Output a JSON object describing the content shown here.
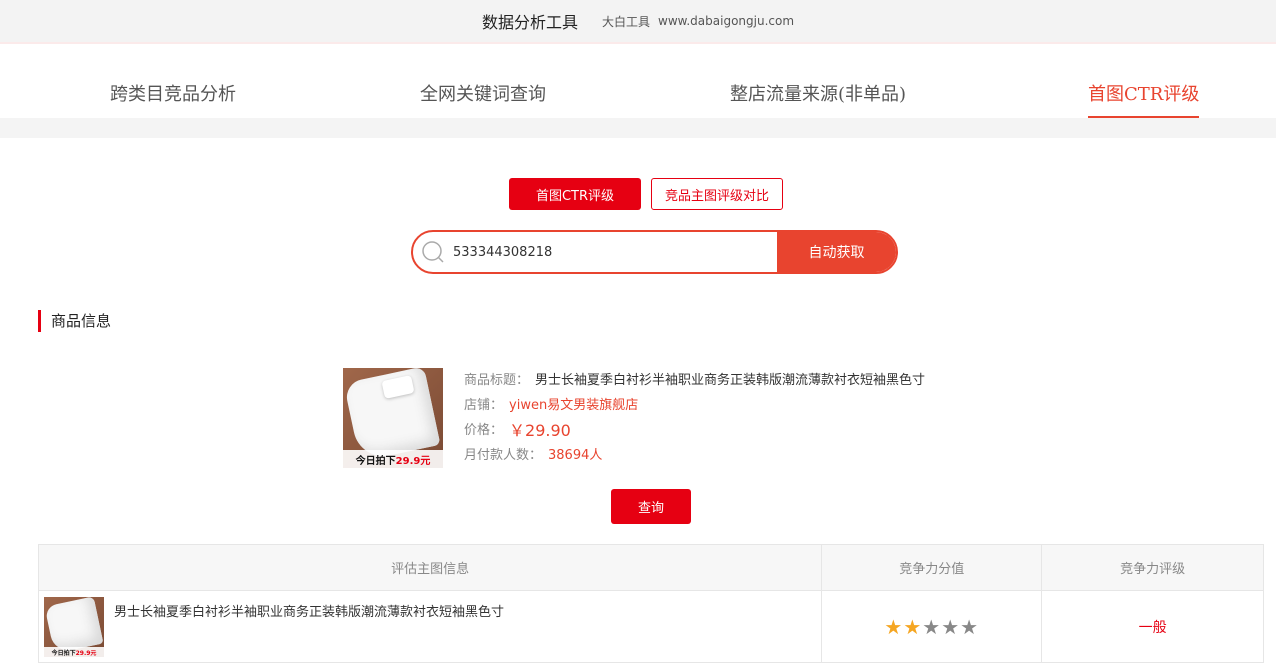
{
  "header": {
    "title": "数据分析工具",
    "brand": "大白工具",
    "url": "www.dabaigongju.com"
  },
  "nav": {
    "tabs": [
      {
        "label": "跨类目竞品分析"
      },
      {
        "label": "全网关键词查询"
      },
      {
        "label": "整店流量来源(非单品)"
      },
      {
        "label": "首图CTR评级"
      }
    ],
    "active": "首图CTR评级"
  },
  "subnav": {
    "primary_label": "首图CTR评级",
    "secondary_label": "竞品主图评级对比"
  },
  "search": {
    "value": "533344308218",
    "button_label": "自动获取"
  },
  "section": {
    "title": "商品信息"
  },
  "product": {
    "image_badge_prefix": "今日拍下",
    "image_badge_price": "29.9元",
    "title_label": "商品标题：",
    "title": "男士长袖夏季白衬衫半袖职业商务正装韩版潮流薄款衬衣短袖黑色寸",
    "shop_label": "店铺：",
    "shop": "yiwen易文男装旗舰店",
    "price_label": "价格：",
    "price": "￥29.90",
    "monthly_label": "月付款人数：",
    "monthly": "38694人"
  },
  "query_button": "查询",
  "table": {
    "headers": [
      "评估主图信息",
      "竞争力分值",
      "竞争力评级"
    ],
    "rows": [
      {
        "title": "男士长袖夏季白衬衫半袖职业商务正装韩版潮流薄款衬衣短袖黑色寸",
        "thumb_badge_prefix": "今日拍下",
        "thumb_badge_price": "29.9元",
        "rating": 2,
        "rating_max": 5,
        "grade": "一般"
      }
    ]
  },
  "colors": {
    "accent": "#e60012",
    "accent_soft": "#e8442f",
    "star": "#f5a623"
  }
}
